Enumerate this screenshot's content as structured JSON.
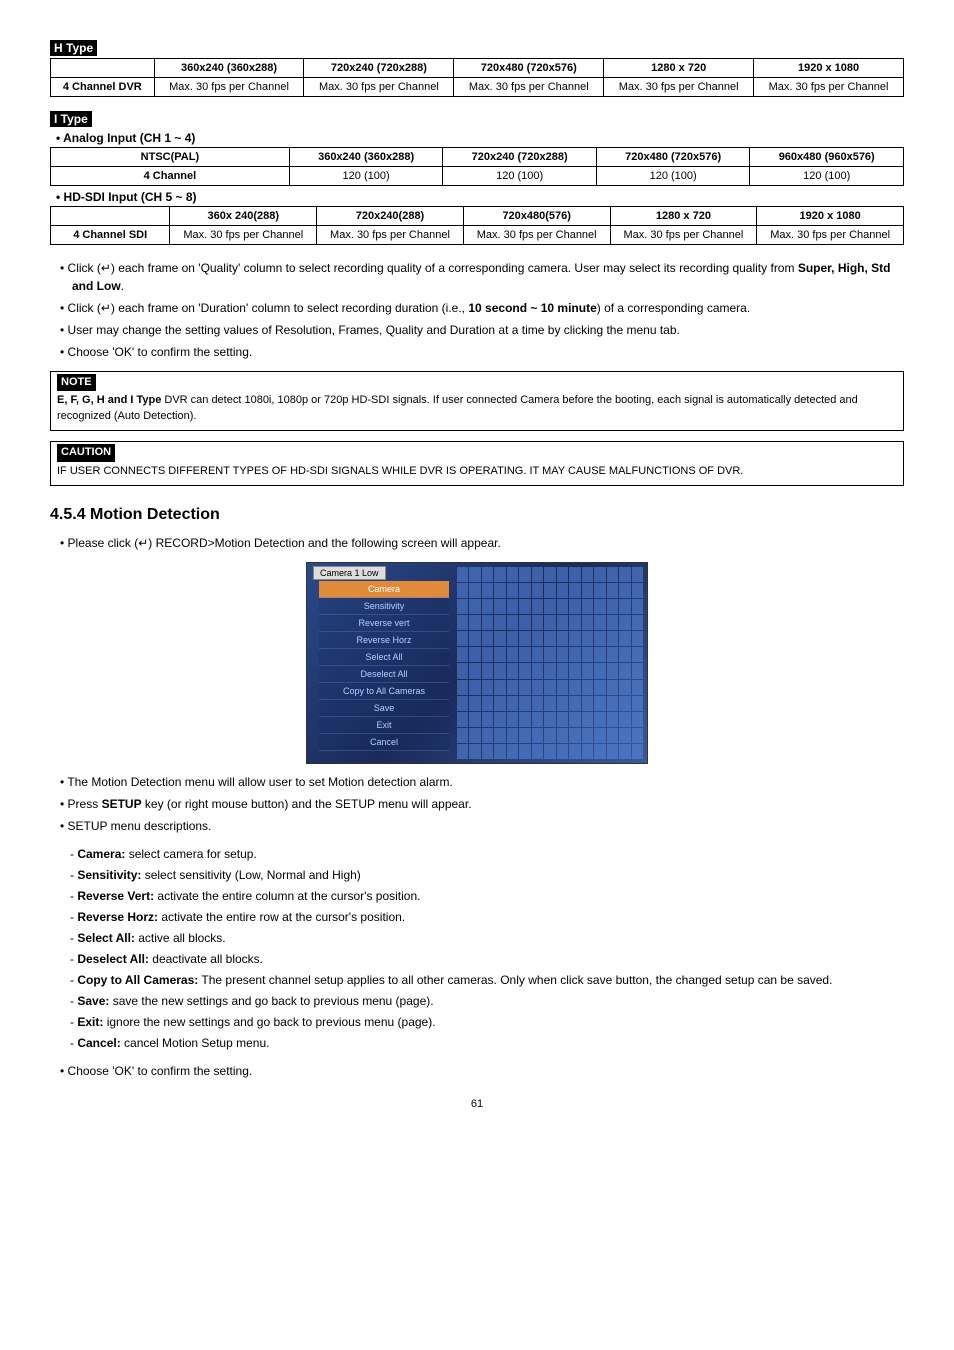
{
  "h_type": {
    "label": "H Type",
    "headers": [
      "",
      "360x240 (360x288)",
      "720x240 (720x288)",
      "720x480 (720x576)",
      "1280 x 720",
      "1920 x 1080"
    ],
    "row": [
      "4 Channel DVR",
      "Max. 30 fps per Channel",
      "Max. 30 fps per Channel",
      "Max. 30 fps per Channel",
      "Max. 30 fps per Channel",
      "Max. 30 fps per Channel"
    ]
  },
  "i_type": {
    "label": "I Type",
    "analog": {
      "heading": "• Analog Input (CH 1 ~ 4)",
      "headers": [
        "NTSC(PAL)",
        "360x240 (360x288)",
        "720x240 (720x288)",
        "720x480 (720x576)",
        "960x480 (960x576)"
      ],
      "row": [
        "4 Channel",
        "120 (100)",
        "120 (100)",
        "120 (100)",
        "120 (100)"
      ]
    },
    "hdsdi": {
      "heading": "• HD-SDI Input (CH 5 ~ 8)",
      "headers": [
        "",
        "360x 240(288)",
        "720x240(288)",
        "720x480(576)",
        "1280 x 720",
        "1920 x 1080"
      ],
      "row": [
        "4 Channel SDI",
        "Max. 30 fps per Channel",
        "Max. 30 fps per Channel",
        "Max. 30 fps per Channel",
        "Max. 30 fps per Channel",
        "Max. 30 fps per Channel"
      ]
    }
  },
  "bullets1": [
    "Click (↵) each frame on 'Quality' column to select recording quality of a corresponding camera. User may select its recording quality from <b>Super, High, Std and Low</b>.",
    "Click (↵) each frame on 'Duration' column to select recording duration (i.e., <b>10 second ~ 10 minute</b>) of a corresponding camera.",
    "User may change the setting values of Resolution, Frames, Quality and Duration at a time by clicking the menu tab.",
    "Choose 'OK' to confirm the setting."
  ],
  "note": {
    "label": "NOTE",
    "text": "<b>E, F, G, H and I Type</b> DVR can detect 1080i, 1080p or 720p HD-SDI signals. If user connected Camera before the booting, each signal is automatically detected and recognized (Auto Detection)."
  },
  "caution": {
    "label": "CAUTION",
    "text": "IF USER CONNECTS DIFFERENT TYPES OF HD-SDI SIGNALS WHILE DVR IS OPERATING. IT MAY CAUSE MALFUNCTIONS OF DVR."
  },
  "section": {
    "title": "4.5.4  Motion Detection",
    "intro": "Please click (↵) RECORD>Motion Detection and the following screen will appear."
  },
  "fig_top": "Camera  1    Low",
  "fig_menu": [
    "Camera",
    "Sensitivity",
    "Reverse vert",
    "Reverse Horz",
    "Select All",
    "Deselect All",
    "Copy to All Cameras",
    "Save",
    "Exit",
    "Cancel"
  ],
  "bullets2": [
    "The Motion Detection menu will allow user to set Motion detection alarm.",
    "Press <b>SETUP</b> key (or right mouse button) and the SETUP menu will appear.",
    "SETUP menu descriptions."
  ],
  "setup_items": [
    "<b>Camera:</b> select camera for setup.",
    "<b>Sensitivity:</b> select sensitivity (Low, Normal and High)",
    "<b>Reverse Vert:</b> activate the entire column at the cursor's position.",
    "<b>Reverse Horz:</b> activate the entire row at the cursor's position.",
    "<b>Select All:</b> active all blocks.",
    "<b>Deselect All:</b> deactivate all blocks.",
    "<b>Copy to All Cameras:</b> The present channel setup applies to all other cameras. Only when click save button, the changed setup can be saved.",
    "<b>Save:</b> save the new settings and go back to previous menu (page).",
    "<b>Exit:</b> ignore the new settings and go back to previous menu (page).",
    "<b>Cancel:</b> cancel Motion Setup menu."
  ],
  "bullets3": [
    "Choose 'OK' to confirm the setting."
  ],
  "page": "61"
}
